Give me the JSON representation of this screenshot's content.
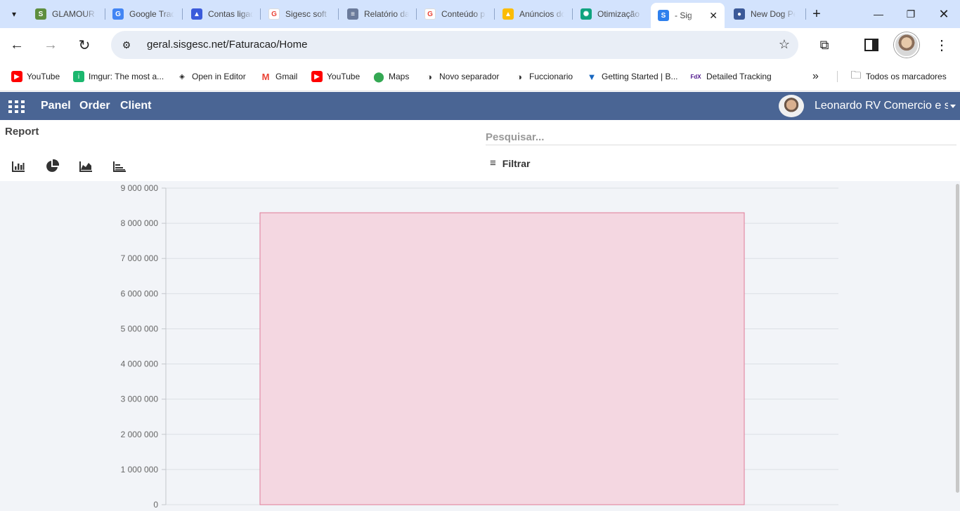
{
  "browser": {
    "tabs": [
      {
        "title": "GLAMOUR",
        "favicon": "shopify-icon",
        "color": "#5e8e3e"
      },
      {
        "title": "Google Trad",
        "favicon": "translate-icon",
        "color": "#4285f4"
      },
      {
        "title": "Contas ligad",
        "favicon": "ads-manager-icon",
        "color": "#3b5bdb"
      },
      {
        "title": "Sigesc soft",
        "favicon": "google-icon",
        "color": "#ea4335"
      },
      {
        "title": "Relatório da",
        "favicon": "report-icon",
        "color": "#6b7b9b"
      },
      {
        "title": "Conteúdo p",
        "favicon": "google-icon",
        "color": "#ea4335"
      },
      {
        "title": "Anúncios do",
        "favicon": "google-ads-icon",
        "color": "#fbbc04"
      },
      {
        "title": "Otimização",
        "favicon": "openai-icon",
        "color": "#10a37f"
      },
      {
        "title": "- Sig",
        "favicon": "sigesc-icon",
        "color": "#2f80ed",
        "active": true
      },
      {
        "title": "New Dog Pe",
        "favicon": "paw-icon",
        "color": "#3b5998"
      }
    ],
    "url": "geral.sisgesc.net/Faturacao/Home",
    "bookmarks": [
      {
        "label": "YouTube",
        "icon": "youtube-icon",
        "color": "#ff0000"
      },
      {
        "label": "Imgur: The most a...",
        "icon": "imgur-icon",
        "color": "#1bb76e"
      },
      {
        "label": "Open in Editor",
        "icon": "codepen-icon",
        "color": "#1f1f1f"
      },
      {
        "label": "Gmail",
        "icon": "gmail-icon",
        "color": "#ea4335"
      },
      {
        "label": "YouTube",
        "icon": "youtube-icon",
        "color": "#ff0000"
      },
      {
        "label": "Maps",
        "icon": "maps-icon",
        "color": "#34a853"
      },
      {
        "label": "Novo separador",
        "icon": "github-icon",
        "color": "#333333"
      },
      {
        "label": "Fuccionario",
        "icon": "github-icon",
        "color": "#333333"
      },
      {
        "label": "Getting Started | B...",
        "icon": "vuetify-icon",
        "color": "#1867c0"
      },
      {
        "label": "Detailed Tracking",
        "icon": "fedex-icon",
        "color": "#4d148c"
      }
    ],
    "all_bookmarks_label": "Todos os marcadores"
  },
  "app": {
    "nav": [
      "Panel",
      "Order",
      "Client"
    ],
    "user_name": "Leonardo RV Comercio e serviços",
    "brand_color": "#4a6594"
  },
  "control": {
    "title": "Report",
    "search_placeholder": "Pesquisar...",
    "filter_label": "Filtrar",
    "view_icons": [
      "bar-chart-icon",
      "pie-chart-icon",
      "area-chart-icon",
      "stacked-chart-icon"
    ]
  },
  "chart_data": {
    "type": "bar",
    "categories": [
      ""
    ],
    "values": [
      8300000
    ],
    "ylim": [
      0,
      9000000
    ],
    "yticks": [
      0,
      1000000,
      2000000,
      3000000,
      4000000,
      5000000,
      6000000,
      7000000,
      8000000,
      9000000
    ],
    "ytick_labels": [
      "0",
      "1 000 000",
      "2 000 000",
      "3 000 000",
      "4 000 000",
      "5 000 000",
      "6 000 000",
      "7 000 000",
      "8 000 000",
      "9 000 000"
    ],
    "bar_fill": "#f4d7e1",
    "bar_stroke": "#e07b97",
    "grid": true
  }
}
